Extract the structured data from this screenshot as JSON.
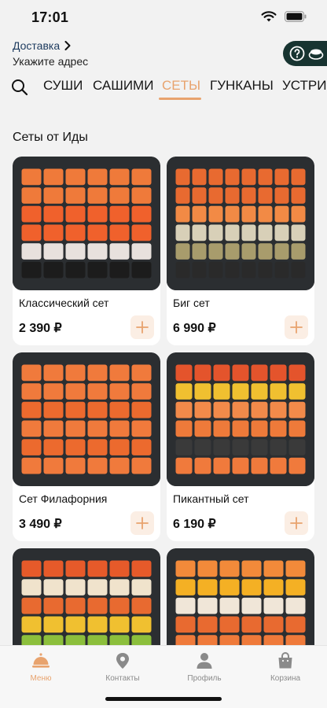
{
  "status": {
    "time": "17:01"
  },
  "header": {
    "delivery_label": "Доставка",
    "address_placeholder": "Укажите адрес"
  },
  "tabs": [
    "СУШИ",
    "САШИМИ",
    "СЕТЫ",
    "ГУНКАНЫ",
    "УСТРИЦ"
  ],
  "active_tab": "СЕТЫ",
  "section": {
    "title": "Сеты от Иды"
  },
  "products": [
    {
      "name": "Классический сет",
      "price": "2 390 ₽"
    },
    {
      "name": "Биг сет",
      "price": "6 990 ₽"
    },
    {
      "name": "Сет Филафорния",
      "price": "3 490 ₽"
    },
    {
      "name": "Пикантный сет",
      "price": "6 190 ₽"
    },
    {
      "name": "",
      "price": ""
    },
    {
      "name": "",
      "price": ""
    }
  ],
  "nav": [
    {
      "label": "Меню",
      "icon": "cloche-icon",
      "active": true
    },
    {
      "label": "Контакты",
      "icon": "location-pin-icon"
    },
    {
      "label": "Профиль",
      "icon": "person-icon"
    },
    {
      "label": "Корзина",
      "icon": "shopping-bag-icon"
    }
  ],
  "colors": {
    "accent": "#e8a36e",
    "accent_bg": "#fbeee4",
    "pill": "#183431"
  }
}
